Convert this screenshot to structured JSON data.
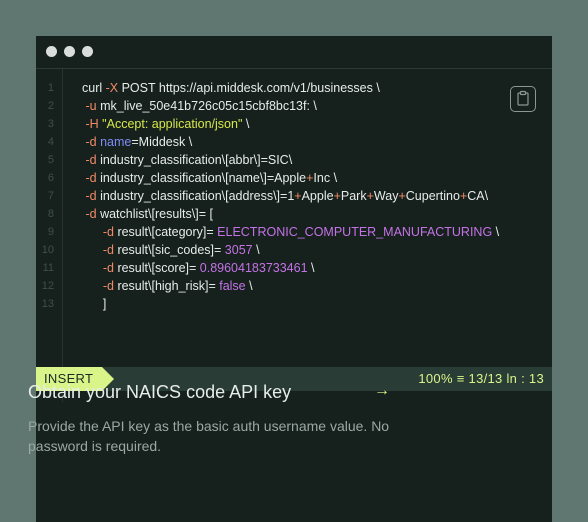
{
  "window": {
    "controls": [
      "dot",
      "dot",
      "dot"
    ]
  },
  "code": {
    "lines": [
      {
        "n": "1",
        "indent": "",
        "tokens": [
          [
            "",
            "curl "
          ],
          [
            "flag",
            "-X"
          ],
          [
            "",
            " POST https://api.middesk.com/v1/businesses \\"
          ]
        ]
      },
      {
        "n": "2",
        "indent": " ",
        "tokens": [
          [
            "flag",
            "-u"
          ],
          [
            "",
            " mk_live_50e41b726c05c15cbf8bc13f: \\"
          ]
        ]
      },
      {
        "n": "3",
        "indent": " ",
        "tokens": [
          [
            "flag",
            "-H"
          ],
          [
            "",
            " "
          ],
          [
            "str",
            "\"Accept: application/json\""
          ],
          [
            "",
            " \\"
          ]
        ]
      },
      {
        "n": "4",
        "indent": " ",
        "tokens": [
          [
            "flag",
            "-d"
          ],
          [
            "",
            " "
          ],
          [
            "key",
            "name"
          ],
          [
            "",
            "=Middesk \\"
          ]
        ]
      },
      {
        "n": "5",
        "indent": " ",
        "tokens": [
          [
            "flag",
            "-d"
          ],
          [
            "",
            " industry_classification\\[abbr\\]=SIC\\"
          ]
        ]
      },
      {
        "n": "6",
        "indent": " ",
        "tokens": [
          [
            "flag",
            "-d"
          ],
          [
            "",
            " industry_classification\\[name\\]=Apple"
          ],
          [
            "op",
            "+"
          ],
          [
            "",
            "Inc \\"
          ]
        ]
      },
      {
        "n": "7",
        "indent": " ",
        "tokens": [
          [
            "flag",
            "-d"
          ],
          [
            "",
            " industry_classification\\[address\\]=1"
          ],
          [
            "op",
            "+"
          ],
          [
            "",
            "Apple"
          ],
          [
            "op",
            "+"
          ],
          [
            "",
            "Park"
          ],
          [
            "op",
            "+"
          ],
          [
            "",
            "Way"
          ],
          [
            "op",
            "+"
          ],
          [
            "",
            "Cupertino"
          ],
          [
            "op",
            "+"
          ],
          [
            "",
            "CA\\"
          ]
        ]
      },
      {
        "n": "8",
        "indent": " ",
        "tokens": [
          [
            "flag",
            "-d"
          ],
          [
            "",
            " watchlist\\[results\\]= ["
          ]
        ]
      },
      {
        "n": "9",
        "indent": "      ",
        "tokens": [
          [
            "flag",
            "-d"
          ],
          [
            "",
            " result\\[category]= "
          ],
          [
            "val",
            "ELECTRONIC_COMPUTER_MANUFACTURING"
          ],
          [
            "",
            " \\"
          ]
        ]
      },
      {
        "n": "10",
        "indent": "      ",
        "tokens": [
          [
            "flag",
            "-d"
          ],
          [
            "",
            " result\\[sic_codes]= "
          ],
          [
            "val",
            "3057"
          ],
          [
            "",
            " \\"
          ]
        ]
      },
      {
        "n": "11",
        "indent": "      ",
        "tokens": [
          [
            "flag",
            "-d"
          ],
          [
            "",
            " result\\[score]= "
          ],
          [
            "val",
            "0.89604183733461"
          ],
          [
            "",
            " \\"
          ]
        ]
      },
      {
        "n": "12",
        "indent": "      ",
        "tokens": [
          [
            "flag",
            "-d"
          ],
          [
            "",
            " result\\[high_risk]= "
          ],
          [
            "val",
            "false"
          ],
          [
            "",
            " \\"
          ]
        ]
      },
      {
        "n": "13",
        "indent": "      ",
        "tokens": [
          [
            "",
            "]"
          ]
        ]
      }
    ]
  },
  "copy_button": {
    "icon": "clipboard-icon"
  },
  "statusbar": {
    "mode": "INSERT",
    "position": "100% ≡ 13/13 ln : 13"
  },
  "card": {
    "title": "Obtain your NAICS code API key",
    "arrow": "→",
    "description": "Provide the API key as the basic auth username value. No password is required."
  }
}
